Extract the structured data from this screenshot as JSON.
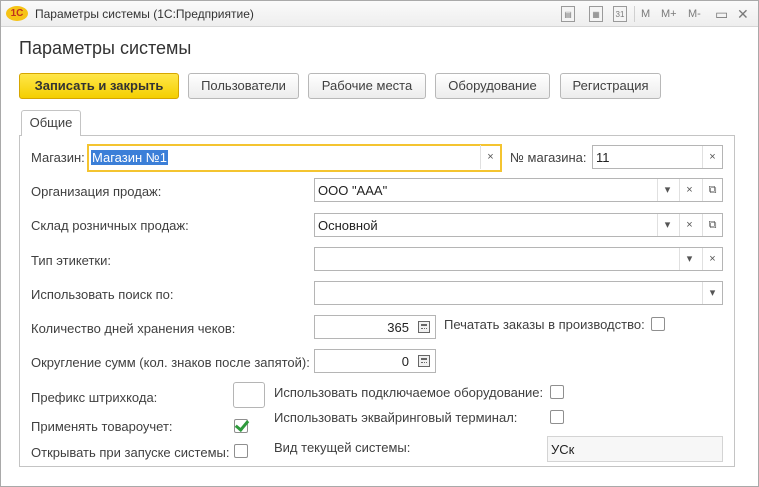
{
  "window": {
    "title": "Параметры системы  (1С:Предприятие)",
    "logo": "1С",
    "toolbar": [
      "M",
      "M+",
      "M-"
    ],
    "calendar_day": "31"
  },
  "form": {
    "title": "Параметры системы",
    "buttons": {
      "save_close": "Записать и закрыть",
      "users": "Пользователи",
      "workplaces": "Рабочие места",
      "equipment": "Оборудование",
      "registration": "Регистрация"
    },
    "tabs": [
      "Общие"
    ]
  },
  "fields": {
    "store": {
      "label": "Магазин:",
      "value": "Магазин №1"
    },
    "store_no": {
      "label": "№ магазина:",
      "value": "11"
    },
    "organization": {
      "label": "Организация продаж:",
      "value": "ООО \"ААА\""
    },
    "warehouse": {
      "label": "Склад розничных продаж:",
      "value": "Основной"
    },
    "label_type": {
      "label": "Тип этикетки:",
      "value": ""
    },
    "search_by": {
      "label": "Использовать поиск по:",
      "value": ""
    },
    "receipt_days": {
      "label": "Количество дней хранения чеков:",
      "value": "365"
    },
    "print_orders": {
      "label": "Печатать заказы в производство:",
      "checked": false
    },
    "rounding": {
      "label": "Округление сумм (кол. знаков после запятой):",
      "value": "0"
    },
    "barcode_prefix": {
      "label": "Префикс штрихкода:",
      "value": ""
    },
    "use_connected_equipment": {
      "label": "Использовать подключаемое оборудование:",
      "checked": false
    },
    "use_inventory": {
      "label": "Применять товароучет:",
      "checked": true
    },
    "use_acquiring": {
      "label": "Использовать эквайринговый терминал:",
      "checked": false
    },
    "open_on_start": {
      "label": "Открывать при запуске системы:",
      "checked": false
    },
    "current_system": {
      "label": "Вид текущей системы:",
      "value": "УСк"
    }
  },
  "glyphs": {
    "clear": "×",
    "dropdown": "▾",
    "open": "⧉"
  },
  "colors": {
    "primary_button": "#f4cf00",
    "focus_border": "#f4c430",
    "check_mark": "#2e9a3c",
    "selection": "#3b7fd8"
  }
}
